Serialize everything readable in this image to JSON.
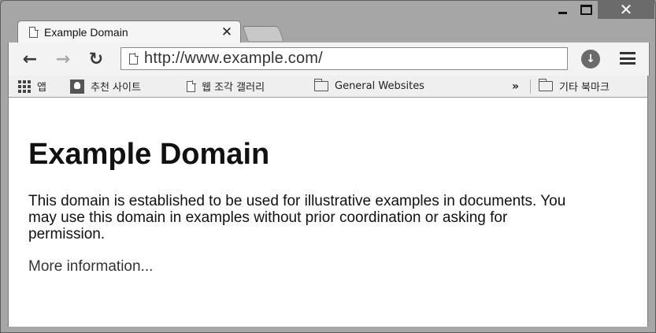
{
  "window": {
    "close_glyph": "✕"
  },
  "tab": {
    "title": "Example Domain",
    "close_glyph": "✕"
  },
  "toolbar": {
    "back_glyph": "←",
    "forward_glyph": "→",
    "reload_glyph": "↻",
    "url": "http://www.example.com/",
    "download_glyph": "↓"
  },
  "bookmarks": {
    "apps": "앱",
    "recommended": "추천 사이트",
    "web_slice": "웹 조각 갤러리",
    "general": "General Websites",
    "more_glyph": "»",
    "other": "기타 북마크"
  },
  "page": {
    "heading": "Example Domain",
    "paragraph": "This domain is established to be used for illustrative examples in documents. You may use this domain in examples without prior coordination or asking for permission.",
    "more_link": "More information..."
  },
  "icons": [
    "page-icon",
    "back-icon",
    "forward-icon",
    "reload-icon",
    "download-icon",
    "menu-icon",
    "apps-icon",
    "bulb-icon",
    "folder-icon"
  ],
  "colors": {
    "frame": "#a6a6a6",
    "close_button": "#6b6b6b",
    "toolbar": "#f3f3f3",
    "content_bg": "#ffffff"
  }
}
